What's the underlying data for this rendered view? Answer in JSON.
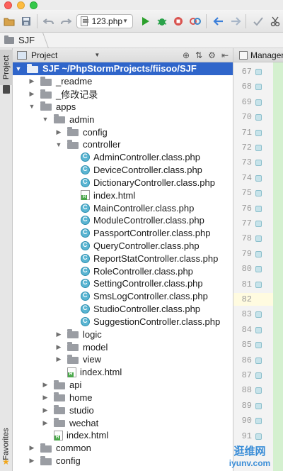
{
  "toolbar": {
    "run_config_label": "123.php",
    "colors": {
      "run": "#2ca02c",
      "debug": "#2aa24a",
      "stop": "#d9534f",
      "back": "#3b7fd9"
    }
  },
  "breadcrumb": {
    "label": "SJF"
  },
  "side_tabs": {
    "project": "Project",
    "favorites": "Favorites"
  },
  "project_panel": {
    "title": "Project",
    "tree": [
      {
        "label": "SJF  ~/PhpStormProjects/fiisoo/SJF",
        "depth": 0,
        "kind": "folder",
        "arrow": "down",
        "selected": true
      },
      {
        "label": "_readme",
        "depth": 1,
        "kind": "folder",
        "arrow": "right"
      },
      {
        "label": "_修改记录",
        "depth": 1,
        "kind": "folder",
        "arrow": "right"
      },
      {
        "label": "apps",
        "depth": 1,
        "kind": "folder",
        "arrow": "down"
      },
      {
        "label": "admin",
        "depth": 2,
        "kind": "folder",
        "arrow": "down"
      },
      {
        "label": "config",
        "depth": 3,
        "kind": "folder",
        "arrow": "right"
      },
      {
        "label": "controller",
        "depth": 3,
        "kind": "folder",
        "arrow": "down"
      },
      {
        "label": "AdminController.class.php",
        "depth": 4,
        "kind": "php"
      },
      {
        "label": "DeviceController.class.php",
        "depth": 4,
        "kind": "php"
      },
      {
        "label": "DictionaryController.class.php",
        "depth": 4,
        "kind": "php"
      },
      {
        "label": "index.html",
        "depth": 4,
        "kind": "html"
      },
      {
        "label": "MainController.class.php",
        "depth": 4,
        "kind": "php"
      },
      {
        "label": "ModuleController.class.php",
        "depth": 4,
        "kind": "php"
      },
      {
        "label": "PassportController.class.php",
        "depth": 4,
        "kind": "php"
      },
      {
        "label": "QueryController.class.php",
        "depth": 4,
        "kind": "php"
      },
      {
        "label": "ReportStatController.class.php",
        "depth": 4,
        "kind": "php"
      },
      {
        "label": "RoleController.class.php",
        "depth": 4,
        "kind": "php"
      },
      {
        "label": "SettingController.class.php",
        "depth": 4,
        "kind": "php"
      },
      {
        "label": "SmsLogController.class.php",
        "depth": 4,
        "kind": "php"
      },
      {
        "label": "StudioController.class.php",
        "depth": 4,
        "kind": "php"
      },
      {
        "label": "SuggestionController.class.php",
        "depth": 4,
        "kind": "php"
      },
      {
        "label": "logic",
        "depth": 3,
        "kind": "folder",
        "arrow": "right"
      },
      {
        "label": "model",
        "depth": 3,
        "kind": "folder",
        "arrow": "right"
      },
      {
        "label": "view",
        "depth": 3,
        "kind": "folder",
        "arrow": "right"
      },
      {
        "label": "index.html",
        "depth": 3,
        "kind": "html"
      },
      {
        "label": "api",
        "depth": 2,
        "kind": "folder",
        "arrow": "right"
      },
      {
        "label": "home",
        "depth": 2,
        "kind": "folder",
        "arrow": "right"
      },
      {
        "label": "studio",
        "depth": 2,
        "kind": "folder",
        "arrow": "right"
      },
      {
        "label": "wechat",
        "depth": 2,
        "kind": "folder",
        "arrow": "right"
      },
      {
        "label": "index.html",
        "depth": 2,
        "kind": "html"
      },
      {
        "label": "common",
        "depth": 1,
        "kind": "folder",
        "arrow": "right"
      },
      {
        "label": "config",
        "depth": 1,
        "kind": "folder",
        "arrow": "right"
      }
    ]
  },
  "editor": {
    "tab_label": "ManagerC",
    "line_numbers": [
      "67",
      "68",
      "69",
      "70",
      "71",
      "72",
      "73",
      "74",
      "75",
      "76",
      "77",
      "78",
      "79",
      "80",
      "81",
      "82",
      "83",
      "84",
      "85",
      "86",
      "87",
      "88",
      "89",
      "90",
      "91"
    ],
    "fold_markers": [
      "67",
      "68",
      "69",
      "70",
      "71",
      "72",
      "73",
      "74",
      "75",
      "76",
      "77",
      "78",
      "79",
      "80",
      "81",
      "83",
      "84",
      "85",
      "86",
      "87",
      "88",
      "89",
      "90",
      "91"
    ],
    "current_line": "82",
    "line_color_accent": "#d4f0cf"
  },
  "watermark": {
    "cn": "逛维网",
    "en": "iyunv.com"
  }
}
